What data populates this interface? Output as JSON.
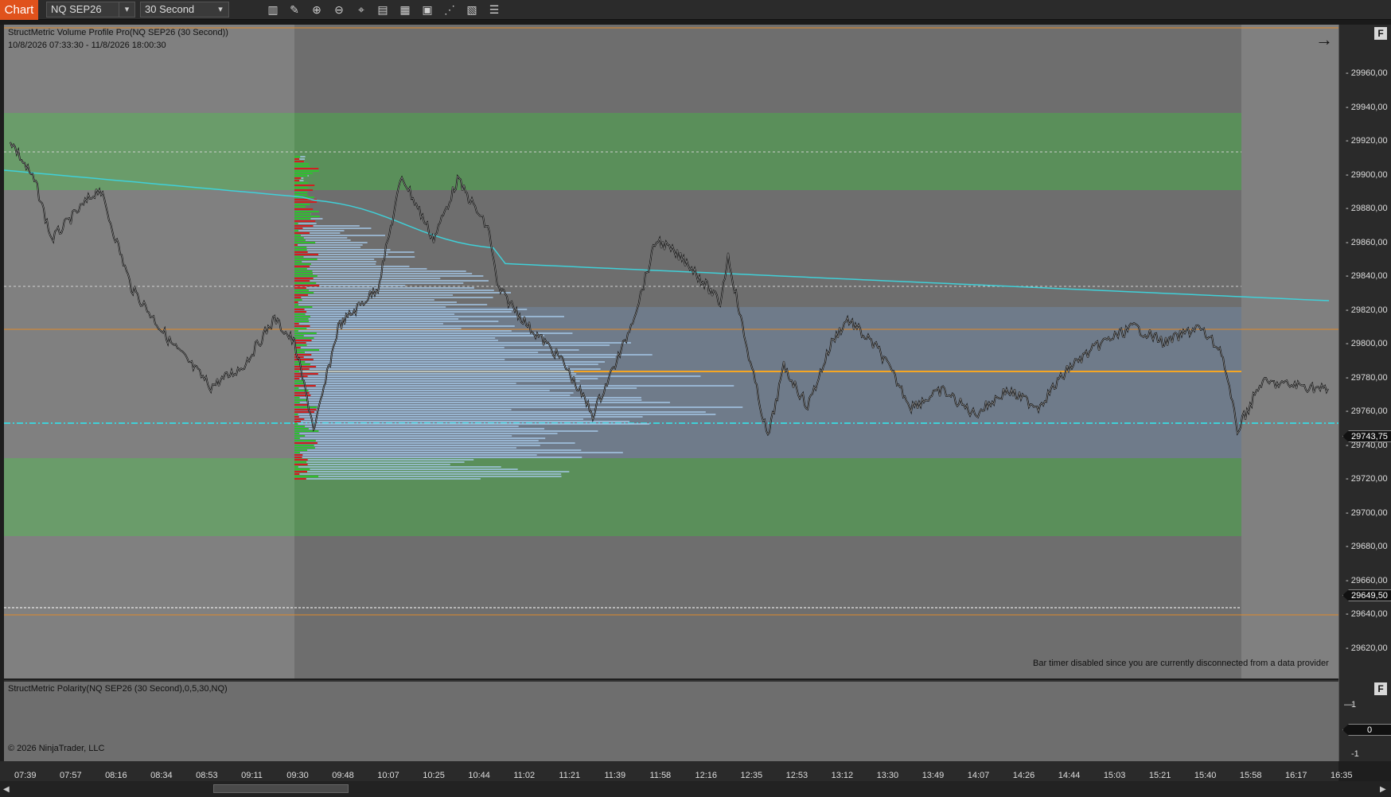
{
  "toolbar": {
    "chart_tab": "Chart",
    "instrument": "NQ SEP26",
    "interval": "30 Second",
    "icons": [
      "bar-type-icon",
      "drawing-tool-icon",
      "zoom-in-icon",
      "zoom-out-icon",
      "crosshair-icon",
      "properties-icon",
      "data-box-icon",
      "chart-trader-icon",
      "strategies-icon",
      "template-icon",
      "indicator-list-icon"
    ]
  },
  "main_panel": {
    "title": "StructMetric Volume Profile Pro(NQ SEP26 (30 Second))",
    "range": "10/8/2026 07:33:30 - 11/8/2026 18:00:30",
    "disconnect_msg": "Bar timer disabled since you are currently disconnected from a data provider",
    "f_button": "F",
    "arrow": "→"
  },
  "indicator_panel": {
    "title": "StructMetric Polarity(NQ SEP26 (30 Second),0,5,30,NQ)",
    "copyright": "© 2026 NinjaTrader, LLC",
    "f_button": "F",
    "ticks": [
      "1",
      "-1"
    ],
    "value_flag": "0"
  },
  "price_axis": {
    "labels": [
      "29960,00",
      "29940,00",
      "29920,00",
      "29900,00",
      "29880,00",
      "29860,00",
      "29840,00",
      "29820,00",
      "29800,00",
      "29780,00",
      "29760,00",
      "29740,00",
      "29720,00",
      "29700,00",
      "29680,00",
      "29660,00",
      "29640,00",
      "29620,00"
    ],
    "last_price": "29743,75",
    "marker_price": "29649,50"
  },
  "time_axis": {
    "labels": [
      "07:39",
      "07:57",
      "08:16",
      "08:34",
      "08:53",
      "09:11",
      "09:30",
      "09:48",
      "10:07",
      "10:25",
      "10:44",
      "11:02",
      "11:21",
      "11:39",
      "11:58",
      "12:16",
      "12:35",
      "12:53",
      "13:12",
      "13:30",
      "13:49",
      "14:07",
      "14:26",
      "14:44",
      "15:03",
      "15:21",
      "15:40",
      "15:58",
      "16:17",
      "16:35"
    ]
  },
  "colors": {
    "accent": "#e0521c",
    "panel_bg": "#6e6e6e",
    "session_bg": "#808080",
    "green_zone": "#5a8f5a",
    "value_area": "#6f7b8a",
    "profile_bar": "#a6c8e8",
    "poc_line": "#f5a623",
    "vwap_line": "#40d0d8",
    "price_line": "#111111"
  }
}
